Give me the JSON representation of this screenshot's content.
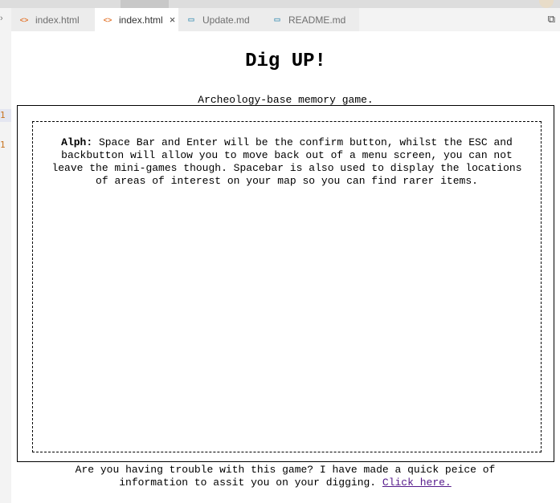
{
  "editor": {
    "tabs": [
      {
        "label": "index.html",
        "icon": "html-file-icon",
        "active": false
      },
      {
        "label": "index.html",
        "icon": "html-file-icon",
        "active": true,
        "close": "×"
      },
      {
        "label": "Update.md",
        "icon": "markdown-file-icon",
        "active": false
      },
      {
        "label": "README.md",
        "icon": "markdown-file-icon",
        "active": false
      }
    ],
    "gutter_marks": [
      "1",
      "1"
    ]
  },
  "page": {
    "title": "Dig UP!",
    "subtitle": "Archeology-base memory game.",
    "instructions": {
      "speaker": "Alph:",
      "text": " Space Bar and Enter will be the confirm button, whilst the ESC and backbutton will allow you to move back out of a menu screen, you can not leave the mini-games though. Spacebar is also used to display the locations of areas of interest on your map so you can find rarer items."
    },
    "footer": {
      "text": "Are you having trouble with this game? I have made a quick peice of information to assit you on your digging. ",
      "link": "Click here."
    }
  },
  "colors": {
    "html_icon": "#e37933",
    "md_icon": "#519aba",
    "link": "#551a8b",
    "gutter_mark": "#c6711c"
  }
}
